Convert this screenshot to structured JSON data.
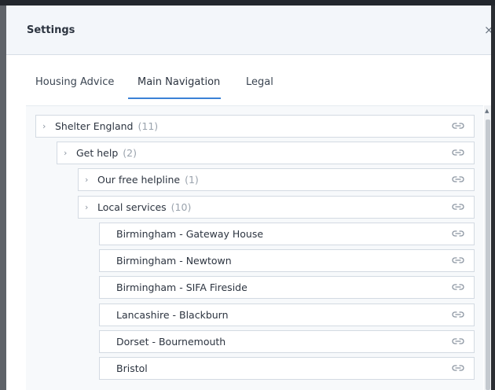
{
  "modal": {
    "title": "Settings",
    "close_icon": "×"
  },
  "tabs": [
    {
      "label": "Housing Advice",
      "active": false
    },
    {
      "label": "Main Navigation",
      "active": true
    },
    {
      "label": "Legal",
      "active": false
    }
  ],
  "tree": [
    {
      "label": "Shelter England",
      "count": "(11)"
    },
    {
      "label": "Get help",
      "count": "(2)"
    },
    {
      "label": "Our free helpline",
      "count": "(1)"
    },
    {
      "label": "Local services",
      "count": "(10)"
    },
    {
      "label": "Birmingham - Gateway House"
    },
    {
      "label": "Birmingham - Newtown"
    },
    {
      "label": "Birmingham - SIFA Fireside"
    },
    {
      "label": "Lancashire - Blackburn"
    },
    {
      "label": "Dorset - Bournemouth"
    },
    {
      "label": "Bristol"
    }
  ],
  "icons": {
    "expand": "chevron-right-icon",
    "link": "link-icon"
  },
  "colors": {
    "accent": "#3b82d6",
    "count": "#9aa3ad"
  }
}
